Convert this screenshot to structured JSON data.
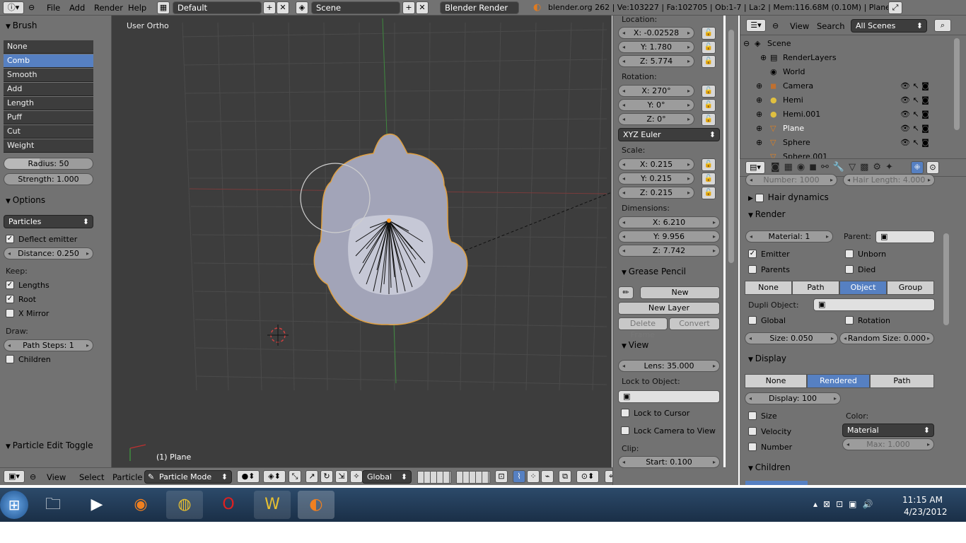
{
  "topbar": {
    "menu": [
      "File",
      "Add",
      "Render",
      "Help"
    ],
    "screen_layout": "Default",
    "scene": "Scene",
    "render_engine": "Blender Render",
    "stats": "blender.org 262 | Ve:103227 | Fa:102705 | Ob:1-7 | La:2 | Mem:116.68M (0.10M) | Plane"
  },
  "left_panel": {
    "brush_header": "Brush",
    "brushes": [
      "None",
      "Comb",
      "Smooth",
      "Add",
      "Length",
      "Puff",
      "Cut",
      "Weight"
    ],
    "active_brush": "Comb",
    "radius": "Radius: 50",
    "strength": "Strength: 1.000",
    "options_header": "Options",
    "options_select": "Particles",
    "deflect_emitter": "Deflect emitter",
    "distance": "Distance: 0.250",
    "keep_label": "Keep:",
    "lengths": "Lengths",
    "root": "Root",
    "x_mirror": "X Mirror",
    "draw_label": "Draw:",
    "path_steps": "Path Steps: 1",
    "children": "Children",
    "toggle_header": "Particle Edit Toggle"
  },
  "viewport": {
    "view_label": "User Ortho",
    "object_label": "(1) Plane"
  },
  "viewport_header": {
    "menus": [
      "View",
      "Select",
      "Particle"
    ],
    "mode": "Particle Mode",
    "orientation": "Global"
  },
  "n_panel": {
    "location_label": "Location:",
    "loc_x": "X: -0.02528",
    "loc_y": "Y: 1.780",
    "loc_z": "Z: 5.774",
    "rotation_label": "Rotation:",
    "rot_x": "X: 270°",
    "rot_y": "Y: 0°",
    "rot_z": "Z: 0°",
    "rot_mode": "XYZ Euler",
    "scale_label": "Scale:",
    "scale_x": "X: 0.215",
    "scale_y": "Y: 0.215",
    "scale_z": "Z: 0.215",
    "dimensions_label": "Dimensions:",
    "dim_x": "X: 6.210",
    "dim_y": "Y: 9.956",
    "dim_z": "Z: 7.742",
    "grease_header": "Grease Pencil",
    "new_btn": "New",
    "new_layer": "New Layer",
    "delete_frame": "Delete Frame",
    "convert": "Convert",
    "view_header": "View",
    "lens": "Lens: 35.000",
    "lock_object_label": "Lock to Object:",
    "lock_cursor": "Lock to Cursor",
    "lock_camera": "Lock Camera to View",
    "clip_label": "Clip:",
    "clip_start": "Start: 0.100"
  },
  "outliner": {
    "view": "View",
    "search": "Search",
    "filter": "All Scenes",
    "rows": [
      {
        "name": "Scene",
        "indent": 0
      },
      {
        "name": "RenderLayers",
        "indent": 1
      },
      {
        "name": "World",
        "indent": 1
      },
      {
        "name": "Camera",
        "indent": 1
      },
      {
        "name": "Hemi",
        "indent": 1
      },
      {
        "name": "Hemi.001",
        "indent": 1
      },
      {
        "name": "Plane",
        "indent": 1
      },
      {
        "name": "Sphere",
        "indent": 1
      },
      {
        "name": "Sphere.001",
        "indent": 1
      }
    ]
  },
  "properties": {
    "number_label": "Number: 1000",
    "hair_length": "Hair Length: 4.000",
    "hair_dynamics": "Hair dynamics",
    "render_header": "Render",
    "material": "Material: 1",
    "parent_label": "Parent:",
    "emitter": "Emitter",
    "unborn": "Unborn",
    "parents": "Parents",
    "died": "Died",
    "render_as": [
      "None",
      "Path",
      "Object",
      "Group"
    ],
    "render_as_active": "Object",
    "dupli_object": "Dupli Object:",
    "global": "Global",
    "rotation": "Rotation",
    "size": "Size: 0.050",
    "random_size": "Random Size: 0.000",
    "display_header": "Display",
    "display_modes": [
      "None",
      "Rendered",
      "Path"
    ],
    "display_active": "Rendered",
    "display_amount": "Display: 100",
    "size_chk": "Size",
    "color_label": "Color:",
    "velocity": "Velocity",
    "color_select": "Material",
    "number_chk": "Number",
    "max": "Max: 1.000",
    "children_header": "Children"
  },
  "taskbar": {
    "time": "11:15 AM",
    "date": "4/23/2012"
  }
}
